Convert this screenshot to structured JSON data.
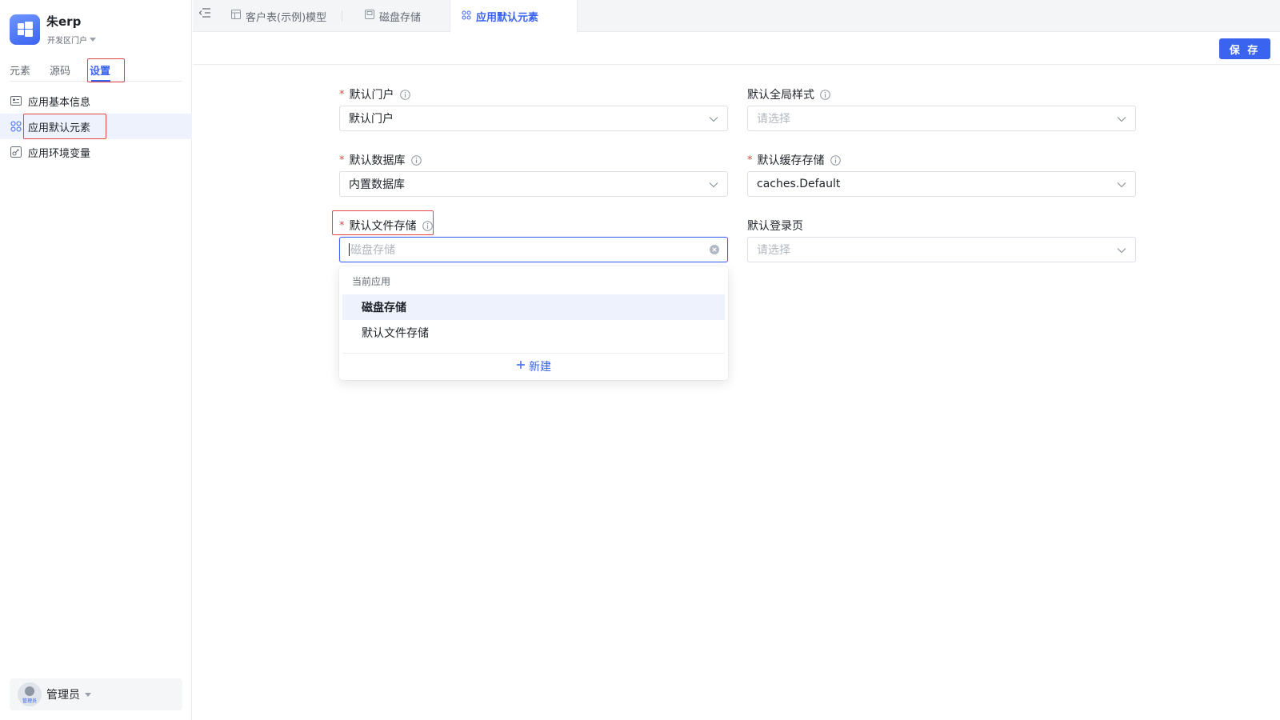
{
  "app": {
    "name": "朱erp",
    "portal": "开发区门户",
    "logo_color": "#3a64f0"
  },
  "sidebar": {
    "tabs": [
      {
        "label": "元素"
      },
      {
        "label": "源码"
      },
      {
        "label": "设置",
        "active": true
      }
    ],
    "menu": [
      {
        "label": "应用基本信息",
        "icon": "id-card-icon"
      },
      {
        "label": "应用默认元素",
        "icon": "grid-icon",
        "active": true
      },
      {
        "label": "应用环境变量",
        "icon": "env-variable-icon"
      }
    ],
    "user": {
      "name": "管理员",
      "avatar_caption": "管理员"
    }
  },
  "topbar": {
    "tabs": [
      {
        "label": "客户表(示例)模型",
        "icon": "table-icon"
      },
      {
        "label": "磁盘存储",
        "icon": "storage-icon"
      },
      {
        "label": "应用默认元素",
        "icon": "grid-icon",
        "active": true
      }
    ]
  },
  "toolbar": {
    "save_label": "保 存"
  },
  "form": {
    "default_portal": {
      "label": "默认门户",
      "required": true,
      "value": "默认门户"
    },
    "default_global_style": {
      "label": "默认全局样式",
      "required": false,
      "placeholder": "请选择"
    },
    "default_database": {
      "label": "默认数据库",
      "required": true,
      "value": "内置数据库"
    },
    "default_cache_storage": {
      "label": "默认缓存存储",
      "required": true,
      "value": "caches.Default"
    },
    "default_file_storage": {
      "label": "默认文件存储",
      "required": true,
      "placeholder": "磁盘存储"
    },
    "default_login_page": {
      "label": "默认登录页",
      "required": false,
      "placeholder": "请选择"
    }
  },
  "dropdown": {
    "group_label": "当前应用",
    "options": [
      {
        "label": "磁盘存储",
        "selected": true
      },
      {
        "label": "默认文件存储"
      }
    ],
    "new_label": "新建"
  },
  "colors": {
    "accent": "#3a64f0",
    "highlight_box": "#e54545",
    "required_mark": "#e54545"
  }
}
